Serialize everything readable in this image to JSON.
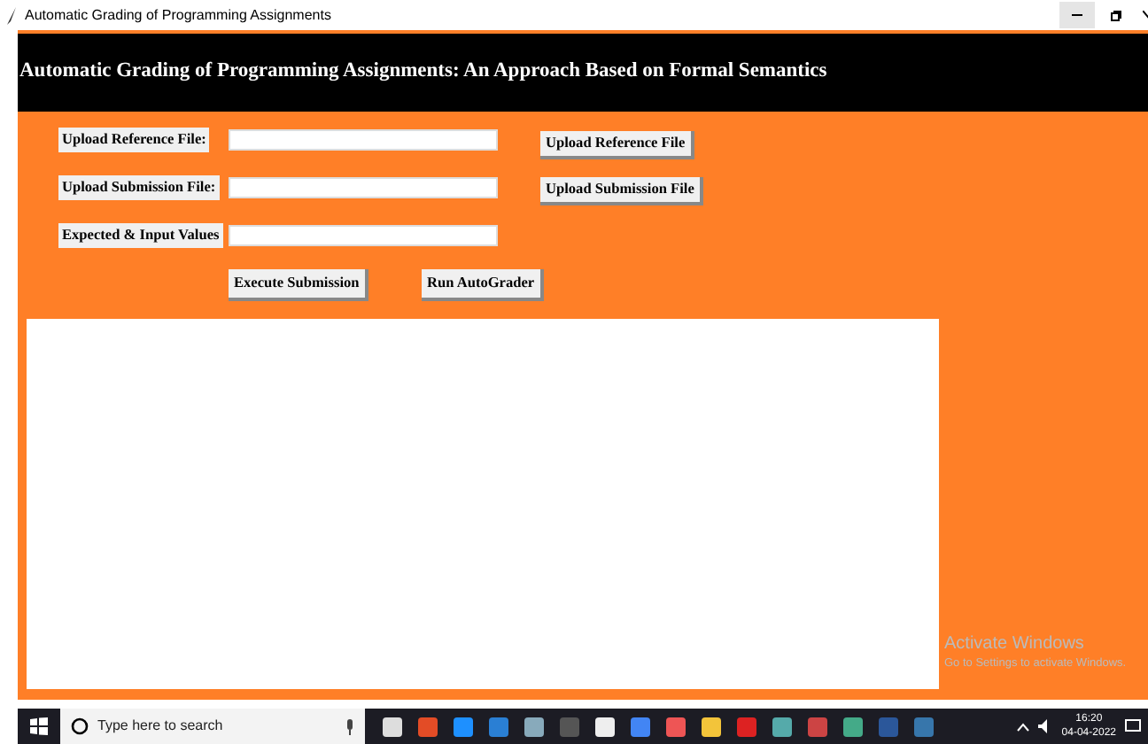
{
  "window": {
    "title": "Automatic Grading of Programming Assignments"
  },
  "header": {
    "title": "Automatic Grading of Programming Assignments: An Approach Based on Formal Semantics"
  },
  "form_rows": [
    {
      "label": "Upload Reference File:",
      "button": "Upload Reference File"
    },
    {
      "label": "Upload Submission File:",
      "button": "Upload Submission File"
    },
    {
      "label": "Expected & Input Values"
    }
  ],
  "actions": [
    "Execute Submission",
    "Run AutoGrader"
  ],
  "os_notice": {
    "title": "Activate Windows",
    "message": "Go to Settings to activate Windows."
  },
  "taskbar": {
    "search_placeholder": "Type here to search",
    "time": "16:20",
    "date": "04-04-2022"
  }
}
